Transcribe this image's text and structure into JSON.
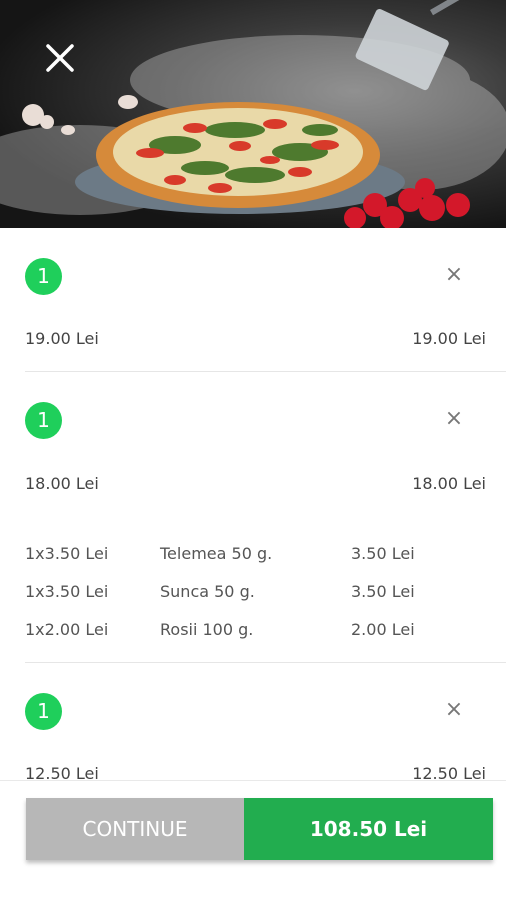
{
  "header": {
    "close_icon": "close-icon",
    "image_subject": "pizza-hero-image"
  },
  "items": [
    {
      "qty": "1",
      "unit_price": "19.00 Lei",
      "total_price": "19.00 Lei",
      "extras": []
    },
    {
      "qty": "1",
      "unit_price": "18.00 Lei",
      "total_price": "18.00 Lei",
      "extras": [
        {
          "qty_price": "1x3.50 Lei",
          "name": "Telemea 50 g.",
          "price": "3.50 Lei"
        },
        {
          "qty_price": "1x3.50 Lei",
          "name": "Sunca 50 g.",
          "price": "3.50 Lei"
        },
        {
          "qty_price": "1x2.00 Lei",
          "name": "Rosii 100 g.",
          "price": "2.00 Lei"
        }
      ]
    },
    {
      "qty": "1",
      "unit_price": "12.50 Lei",
      "total_price": "12.50 Lei",
      "extras": []
    }
  ],
  "footer": {
    "continue_label": "CONTINUE",
    "total_label": "108.50 Lei"
  },
  "colors": {
    "badge_green": "#1fcf5b",
    "total_green": "#22ad4f",
    "continue_gray": "#b7b7b7"
  }
}
